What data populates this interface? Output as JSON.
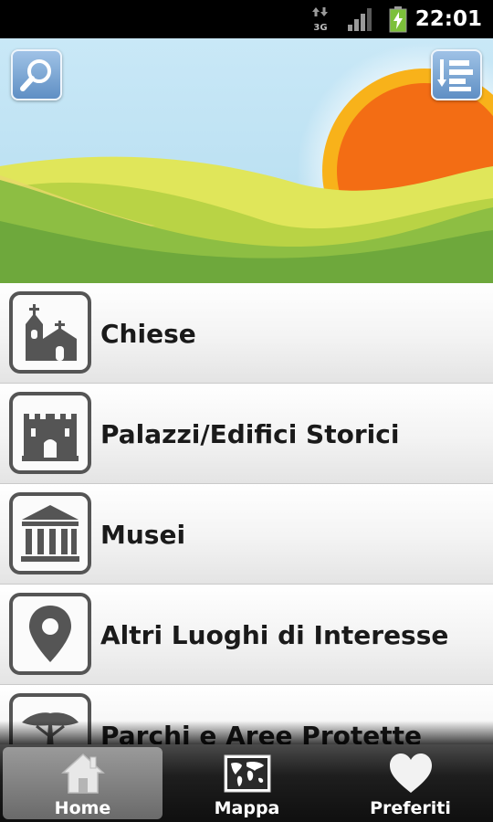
{
  "status_bar": {
    "time": "22:01",
    "network_label": "3G",
    "icons": [
      "data-transfer-icon",
      "signal-icon",
      "battery-charging-icon"
    ]
  },
  "header": {
    "search_icon": "search-icon",
    "sort_icon": "sort-list-icon"
  },
  "categories": [
    {
      "label": "Chiese",
      "icon": "church-icon"
    },
    {
      "label": "Palazzi/Edifici Storici",
      "icon": "castle-icon"
    },
    {
      "label": "Musei",
      "icon": "museum-icon"
    },
    {
      "label": "Altri Luoghi di Interesse",
      "icon": "map-pin-icon"
    },
    {
      "label": "Parchi e Aree Protette",
      "icon": "tree-icon"
    }
  ],
  "tabs": [
    {
      "label": "Home",
      "icon": "home-icon",
      "active": true
    },
    {
      "label": "Mappa",
      "icon": "world-map-icon",
      "active": false
    },
    {
      "label": "Preferiti",
      "icon": "heart-icon",
      "active": false
    }
  ],
  "colors": {
    "sky": "#bfe3f5",
    "sun": "#f2871c",
    "hill_light": "#c8da4a",
    "hill_dark": "#6ea83c",
    "icon_gray": "#555555",
    "header_button": "#7ba6d6"
  }
}
